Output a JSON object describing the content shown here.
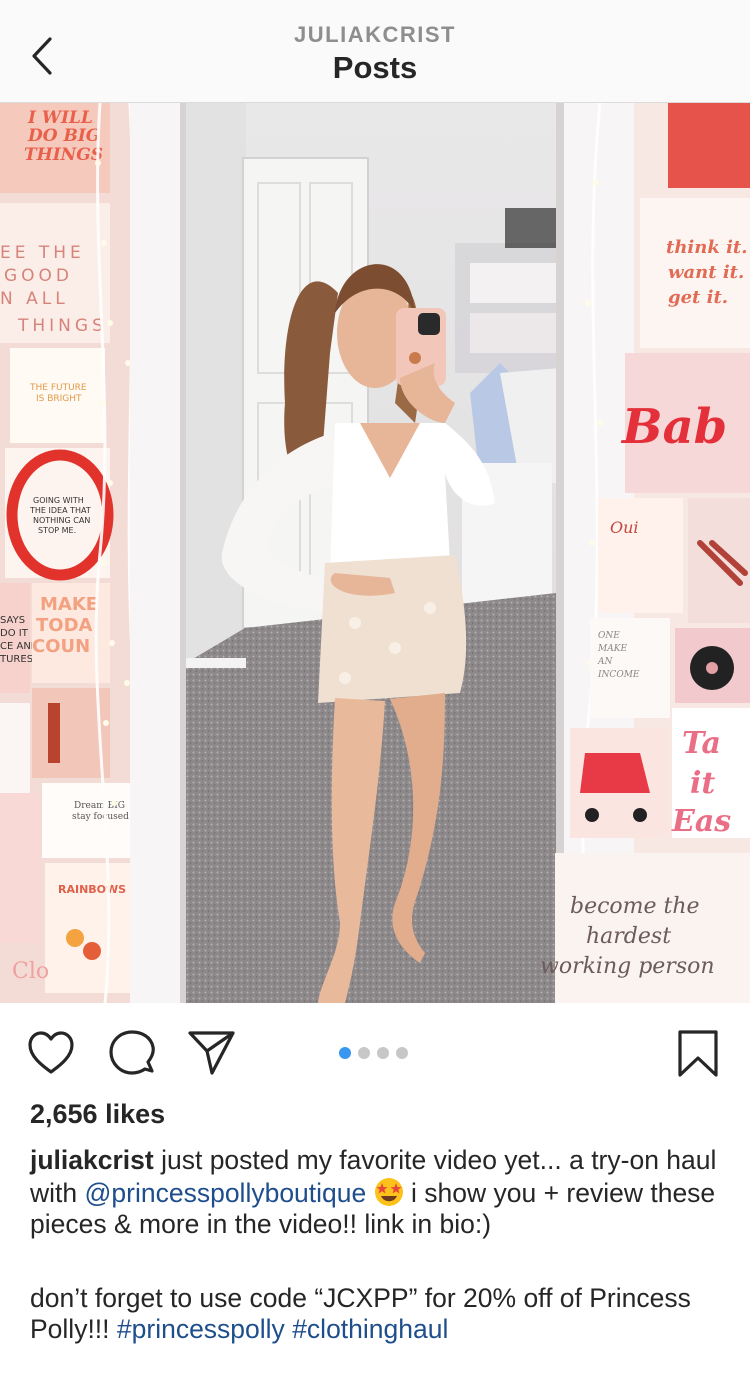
{
  "header": {
    "username": "JULIAKCRIST",
    "title": "Posts",
    "back_icon": "chevron-left-icon"
  },
  "post": {
    "image_description": "Photo of a woman taking a mirror selfie in a white wrap top and light floral skirt, beside a wall collage of pink quote posters and string lights",
    "poster_texts": [
      "I WILL DO BIG THINGS",
      "SEE THE GOOD IN ALL THINGS",
      "think it. want it. get it.",
      "become the hardest working person"
    ],
    "carousel": {
      "count": 4,
      "active_index": 0,
      "active_color": "#3897f0",
      "inactive_color": "#c7c7c7"
    }
  },
  "actions": {
    "like_icon": "heart-icon",
    "comment_icon": "comment-icon",
    "share_icon": "paper-plane-icon",
    "save_icon": "bookmark-icon"
  },
  "likes": "2,656 likes",
  "caption": {
    "username": "juliakcrist",
    "text_1": " just posted my favorite video yet... a try-on haul with ",
    "mention": "@princesspollyboutique",
    "emoji": "star-struck-emoji",
    "text_2": " i show you + review these pieces & more in the video!! link in bio:)",
    "p2_text": "don’t forget to use code “JCXPP” for 20% off of Princess Polly!!! ",
    "hashtag_1": "#princesspolly",
    "hashtag_2": "#clothinghaul",
    "link_color": "#1e4e8c"
  }
}
